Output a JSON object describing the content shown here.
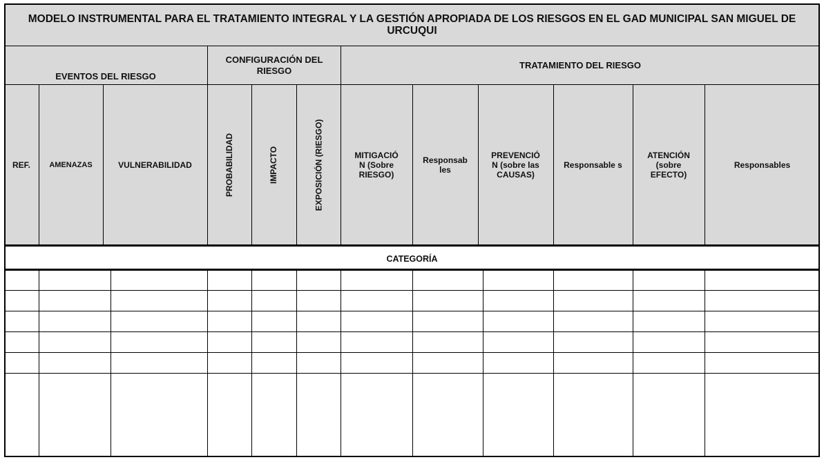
{
  "title": "MODELO INSTRUMENTAL PARA EL TRATAMIENTO INTEGRAL Y LA GESTIÓN APROPIADA DE LOS RIESGOS EN EL GAD MUNICIPAL SAN MIGUEL DE URCUQUI",
  "sections": {
    "eventos": "EVENTOS DEL RIESGO",
    "configuracion": "CONFIGURACIÓN DEL RIESGO",
    "tratamiento": "TRATAMIENTO DEL RIESGO"
  },
  "columns": {
    "ref": "REF.",
    "amenazas": "AMENAZAS",
    "vulnerabilidad": "VULNERABILIDAD",
    "probabilidad": "PROBABILIDAD",
    "impacto": "IMPACTO",
    "exposicion": "EXPOSICIÓN (RIESGO)",
    "mitigacion": "MITIGACIÓ N (Sobre RIESGO)",
    "responsables_1": "Responsab les",
    "prevencion": "PREVENCIÓ N (sobre las CAUSAS)",
    "responsables_2": "Responsable s",
    "atencion": "ATENCIÓN (sobre EFECTO)",
    "responsables_3": "Responsables"
  },
  "category_label": "CATEGORÍA",
  "blank_rows": 6,
  "colors": {
    "header_fill": "#d9d9d9",
    "line": "#000000"
  }
}
